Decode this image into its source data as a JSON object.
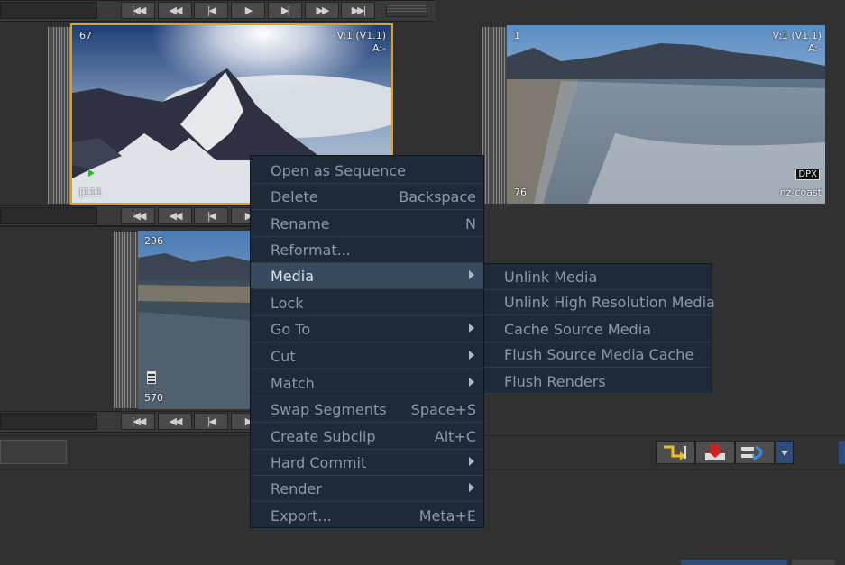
{
  "transport_buttons": [
    "|◀◀",
    "◀◀",
    "|◀",
    "▶",
    "▶|",
    "▶▶",
    "▶▶|"
  ],
  "clips": {
    "mountain": {
      "frame_count": "67",
      "version": "V:1 (V1.1)",
      "audio": "A:-",
      "bottom_left": "[111"
    },
    "coast": {
      "frame_count": "1",
      "version": "V:1 (V1.1)",
      "audio": "A:-",
      "format_badge": "DPX",
      "bottom_left": "76",
      "name": "nz-coast"
    },
    "river": {
      "frame_count": "296",
      "bottom_left": "570"
    }
  },
  "context_menu": {
    "items": [
      {
        "label": "Open as Sequence",
        "shortcut": ""
      },
      {
        "label": "Delete",
        "shortcut": "Backspace"
      },
      {
        "label": "Rename",
        "shortcut": "N"
      },
      {
        "label": "Reformat...",
        "shortcut": ""
      },
      {
        "label": "Media",
        "shortcut": ""
      },
      {
        "label": "Lock",
        "shortcut": ""
      },
      {
        "label": "Go To",
        "shortcut": ""
      },
      {
        "label": "Cut",
        "shortcut": ""
      },
      {
        "label": "Match",
        "shortcut": ""
      },
      {
        "label": "Swap Segments",
        "shortcut": "Space+S"
      },
      {
        "label": "Create Subclip",
        "shortcut": "Alt+C"
      },
      {
        "label": "Hard Commit",
        "shortcut": ""
      },
      {
        "label": "Render",
        "shortcut": ""
      },
      {
        "label": "Export...",
        "shortcut": "Meta+E"
      }
    ]
  },
  "submenu": {
    "items": [
      {
        "label": "Unlink Media"
      },
      {
        "label": "Unlink High Resolution Media"
      },
      {
        "label": "Cache Source Media"
      },
      {
        "label": "Flush Source Media Cache"
      },
      {
        "label": "Flush Renders"
      }
    ]
  },
  "colors": {
    "accent_selection": "#e0a21a",
    "menu_bg": "#1e2a38",
    "menu_highlight": "#374a5e"
  },
  "toolbar_icons": [
    "insert-edit-icon",
    "overwrite-edit-icon",
    "replace-edit-icon",
    "dropdown-arrow-icon"
  ]
}
